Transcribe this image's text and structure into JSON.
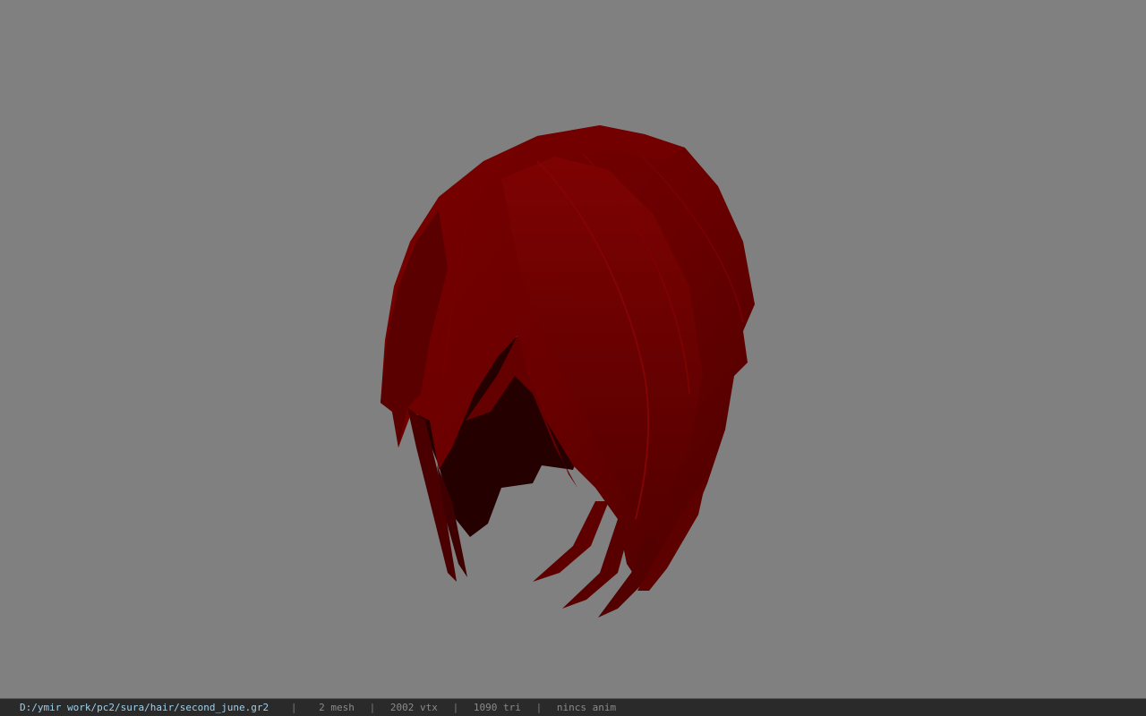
{
  "viewer": {
    "background_color": "#808080",
    "model": {
      "name": "hair-mesh",
      "base_color": "#6e0000",
      "shadow_color": "#2a0000",
      "highlight_color": "#8a0808"
    }
  },
  "status_bar": {
    "file_path": "D:/ymir work/pc2/sura/hair/second_june.gr2",
    "separator": "|",
    "mesh_count": "2 mesh",
    "vertex_count": "2002 vtx",
    "triangle_count": "1090 tri",
    "animation_status": "nincs anim"
  }
}
